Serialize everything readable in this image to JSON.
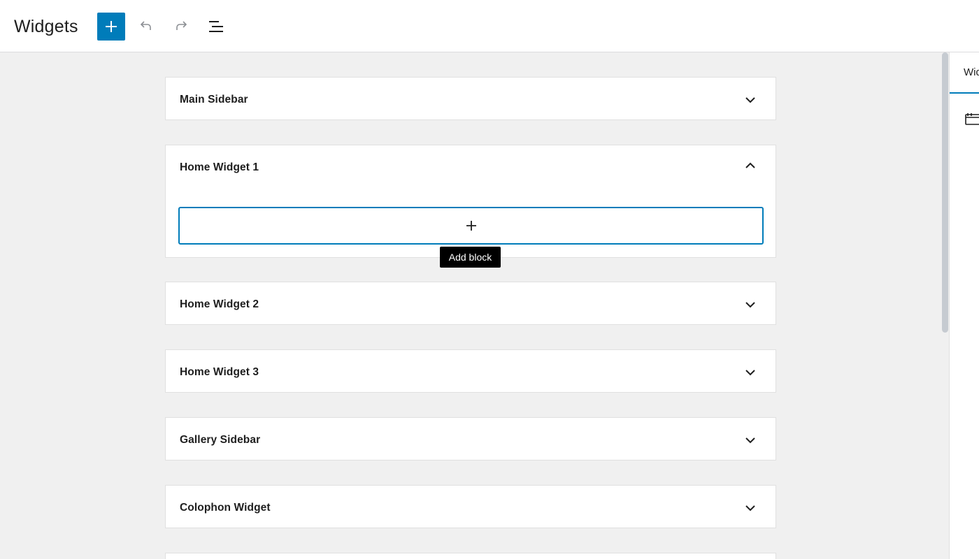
{
  "header": {
    "title": "Widgets",
    "add_label": "+",
    "colors": {
      "accent": "#007cba"
    }
  },
  "widget_areas": [
    {
      "title": "Main Sidebar",
      "expanded": false
    },
    {
      "title": "Home Widget 1",
      "expanded": true
    },
    {
      "title": "Home Widget 2",
      "expanded": false
    },
    {
      "title": "Home Widget 3",
      "expanded": false
    },
    {
      "title": "Gallery Sidebar",
      "expanded": false
    },
    {
      "title": "Colophon Widget",
      "expanded": false
    }
  ],
  "appender": {
    "tooltip": "Add block"
  },
  "sidebar": {
    "tab_label": "Widget Areas",
    "icon": "block-default-icon"
  }
}
